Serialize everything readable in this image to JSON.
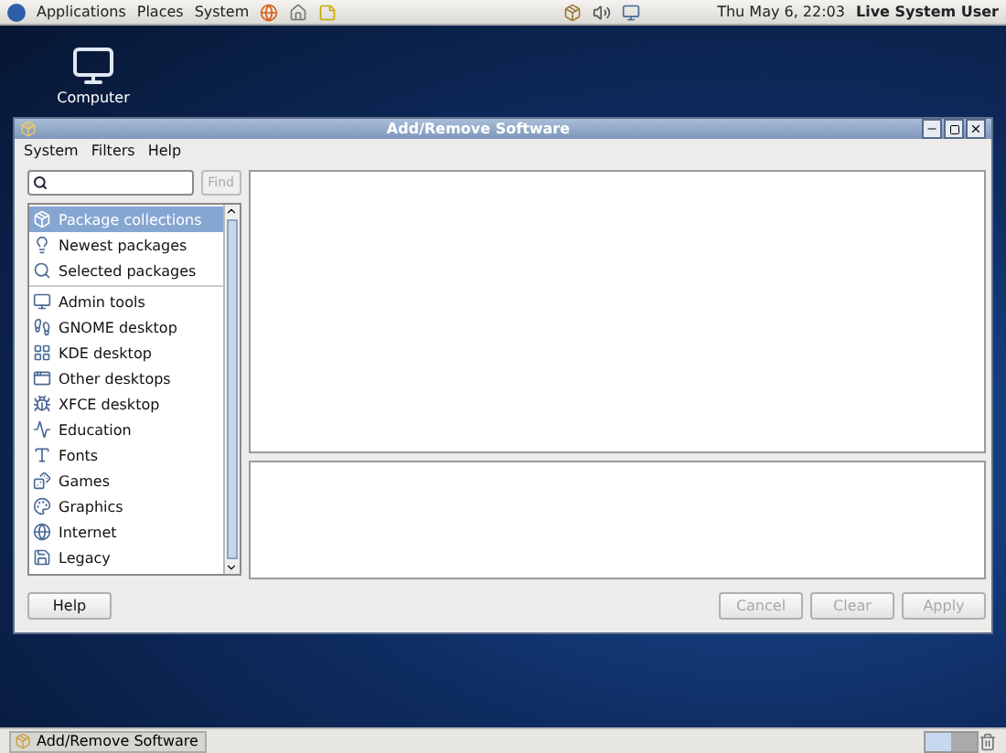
{
  "top_panel": {
    "menus": [
      "Applications",
      "Places",
      "System"
    ],
    "clock": "Thu May  6, 22:03",
    "user": "Live System User"
  },
  "desktop": {
    "icons": [
      "Computer"
    ]
  },
  "window": {
    "title": "Add/Remove Software",
    "menus": [
      "System",
      "Filters",
      "Help"
    ],
    "search": {
      "button": "Find",
      "disabled": true
    },
    "collections": [
      {
        "label": "Package collections",
        "selected": true
      },
      {
        "label": "Newest packages",
        "selected": false
      },
      {
        "label": "Selected packages",
        "selected": false
      }
    ],
    "groups": [
      {
        "label": "Admin tools",
        "selected": false
      },
      {
        "label": "GNOME desktop",
        "selected": false
      },
      {
        "label": "KDE desktop",
        "selected": false
      },
      {
        "label": "Other desktops",
        "selected": false
      },
      {
        "label": "XFCE desktop",
        "selected": false
      },
      {
        "label": "Education",
        "selected": false
      },
      {
        "label": "Fonts",
        "selected": false
      },
      {
        "label": "Games",
        "selected": false
      },
      {
        "label": "Graphics",
        "selected": false
      },
      {
        "label": "Internet",
        "selected": false
      },
      {
        "label": "Legacy",
        "selected": false
      }
    ],
    "buttons": [
      {
        "label": "Help",
        "disabled": false
      },
      {
        "label": "Cancel",
        "disabled": true
      },
      {
        "label": "Clear",
        "disabled": true
      },
      {
        "label": "Apply",
        "disabled": true
      }
    ]
  },
  "taskbar": {
    "items": [
      "Add/Remove Software"
    ]
  }
}
